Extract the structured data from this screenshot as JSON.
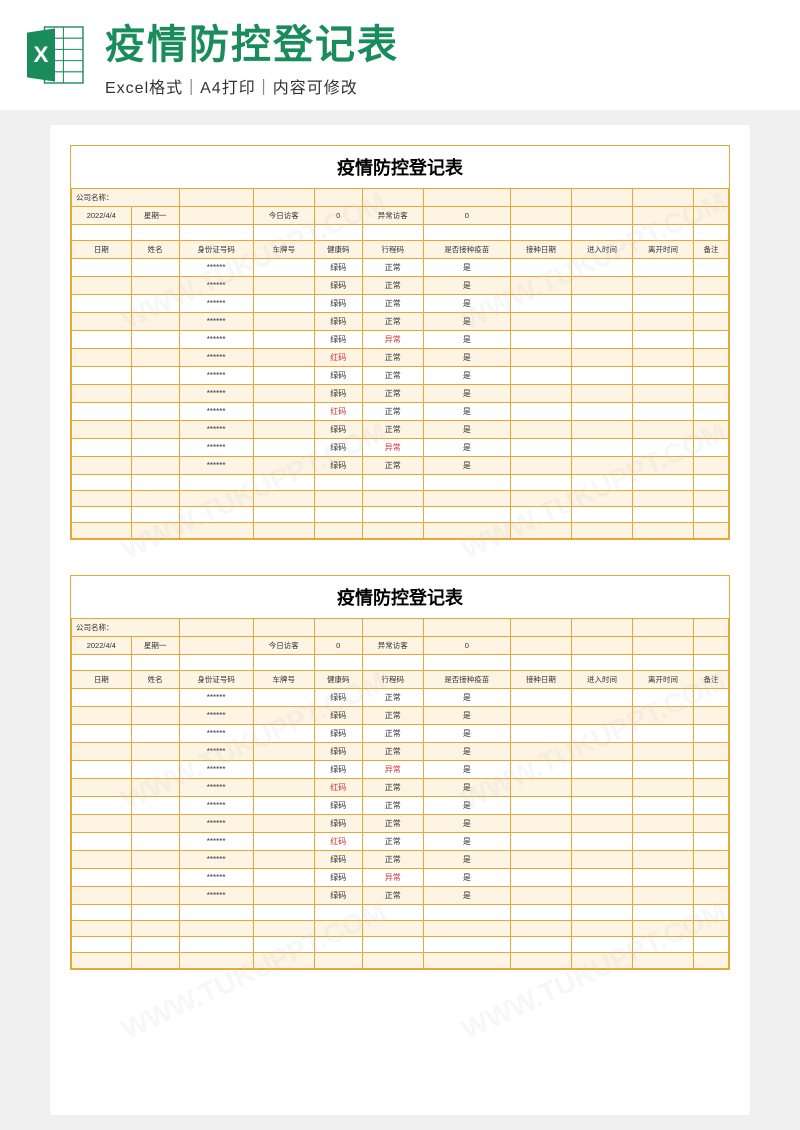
{
  "header": {
    "main_title": "疫情防控登记表",
    "sub_title": "Excel格式｜A4打印｜内容可修改"
  },
  "sheet": {
    "title": "疫情防控登记表",
    "company_label": "公司名称：",
    "date": "2022/4/4",
    "weekday": "星期一",
    "today_visitors_label": "今日访客",
    "today_visitors_value": "0",
    "abnormal_visitors_label": "异常访客",
    "abnormal_visitors_value": "0",
    "columns": [
      "日期",
      "姓名",
      "身份证号码",
      "车牌号",
      "健康码",
      "行程码",
      "是否接种疫苗",
      "接种日期",
      "进入时间",
      "离开时间",
      "备注"
    ],
    "rows": [
      {
        "id": "******",
        "health": "绿码",
        "health_red": false,
        "travel": "正常",
        "travel_red": false,
        "vaccine": "是"
      },
      {
        "id": "******",
        "health": "绿码",
        "health_red": false,
        "travel": "正常",
        "travel_red": false,
        "vaccine": "是"
      },
      {
        "id": "******",
        "health": "绿码",
        "health_red": false,
        "travel": "正常",
        "travel_red": false,
        "vaccine": "是"
      },
      {
        "id": "******",
        "health": "绿码",
        "health_red": false,
        "travel": "正常",
        "travel_red": false,
        "vaccine": "是"
      },
      {
        "id": "******",
        "health": "绿码",
        "health_red": false,
        "travel": "异常",
        "travel_red": true,
        "vaccine": "是"
      },
      {
        "id": "******",
        "health": "红码",
        "health_red": true,
        "travel": "正常",
        "travel_red": false,
        "vaccine": "是"
      },
      {
        "id": "******",
        "health": "绿码",
        "health_red": false,
        "travel": "正常",
        "travel_red": false,
        "vaccine": "是"
      },
      {
        "id": "******",
        "health": "绿码",
        "health_red": false,
        "travel": "正常",
        "travel_red": false,
        "vaccine": "是"
      },
      {
        "id": "******",
        "health": "红码",
        "health_red": true,
        "travel": "正常",
        "travel_red": false,
        "vaccine": "是"
      },
      {
        "id": "******",
        "health": "绿码",
        "health_red": false,
        "travel": "正常",
        "travel_red": false,
        "vaccine": "是"
      },
      {
        "id": "******",
        "health": "绿码",
        "health_red": false,
        "travel": "异常",
        "travel_red": true,
        "vaccine": "是"
      },
      {
        "id": "******",
        "health": "绿码",
        "health_red": false,
        "travel": "正常",
        "travel_red": false,
        "vaccine": "是"
      }
    ],
    "empty_rows": 4
  },
  "watermark": "WWW.TUKUPPT.COM"
}
